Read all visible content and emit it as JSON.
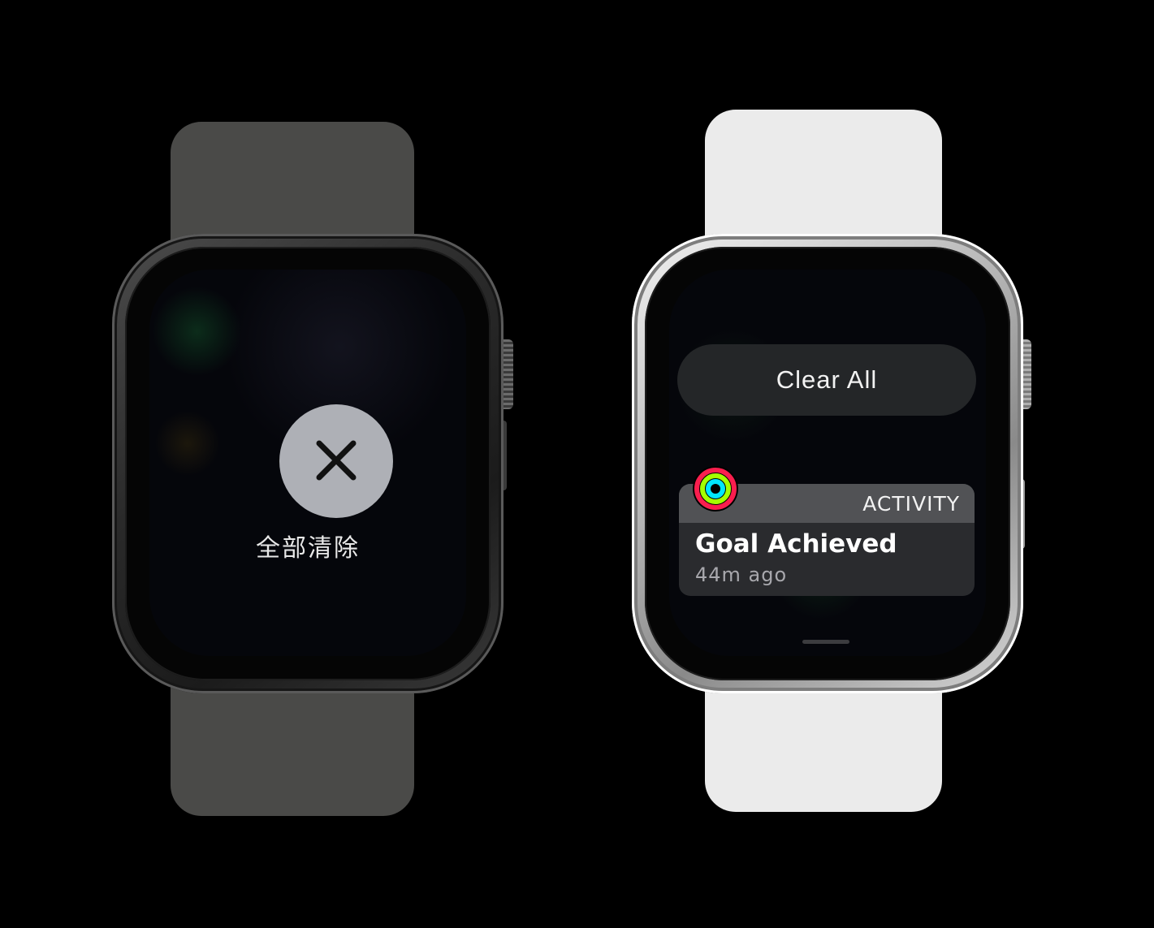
{
  "left_watch": {
    "clear_label": "全部清除",
    "clear_icon": "close-icon"
  },
  "right_watch": {
    "clear_all_label": "Clear All",
    "notification": {
      "app_name": "ACTIVITY",
      "title": "Goal Achieved",
      "time": "44m ago",
      "app_icon": "activity-rings-icon"
    }
  },
  "colors": {
    "background": "#000000",
    "left_band": "#4a4a48",
    "right_band": "#ebebeb",
    "clear_circle": "#aeb0b6",
    "clear_all_button": "#242628",
    "notification_header": "#515255",
    "notification_body": "#2a2b2e",
    "ring_move": "#fa1e4e",
    "ring_exercise": "#a4ff00",
    "ring_stand": "#00e5ff"
  }
}
